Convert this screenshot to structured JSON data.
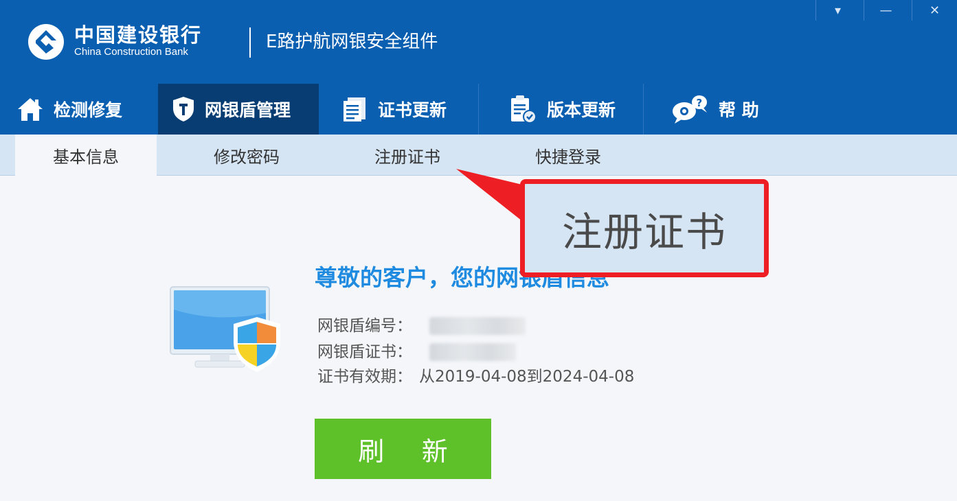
{
  "header": {
    "brand_cn": "中国建设银行",
    "brand_en": "China Construction Bank",
    "product_name": "E路护航网银安全组件",
    "window_controls": [
      "▾",
      "—",
      "✕"
    ],
    "colors": {
      "header_bg": "#0a5fb0",
      "nav_active": "#073d72"
    }
  },
  "nav": {
    "items": [
      {
        "label": "检测修复",
        "icon": "home-icon"
      },
      {
        "label": "网银盾管理",
        "icon": "shield-icon",
        "active": true
      },
      {
        "label": "证书更新",
        "icon": "document-icon"
      },
      {
        "label": "版本更新",
        "icon": "clipboard-icon"
      },
      {
        "label": "帮 助",
        "icon": "help-icon"
      }
    ]
  },
  "subtabs": {
    "items": [
      {
        "label": "基本信息",
        "active": true
      },
      {
        "label": "修改密码"
      },
      {
        "label": "注册证书"
      },
      {
        "label": "快捷登录"
      }
    ]
  },
  "content": {
    "greeting": "尊敬的客户，您的网银盾信息",
    "fields": [
      {
        "label": "网银盾编号：",
        "value": ""
      },
      {
        "label": "网银盾证书：",
        "value": ""
      },
      {
        "label": "证书有效期：",
        "value": "从2019-04-08到2024-04-08"
      }
    ],
    "refresh_label": "刷 新",
    "colors": {
      "greeting": "#1f8be0",
      "refresh_bg": "#5fc12a"
    }
  },
  "callout": {
    "text": "注册证书",
    "border_color": "#ee1f24"
  }
}
